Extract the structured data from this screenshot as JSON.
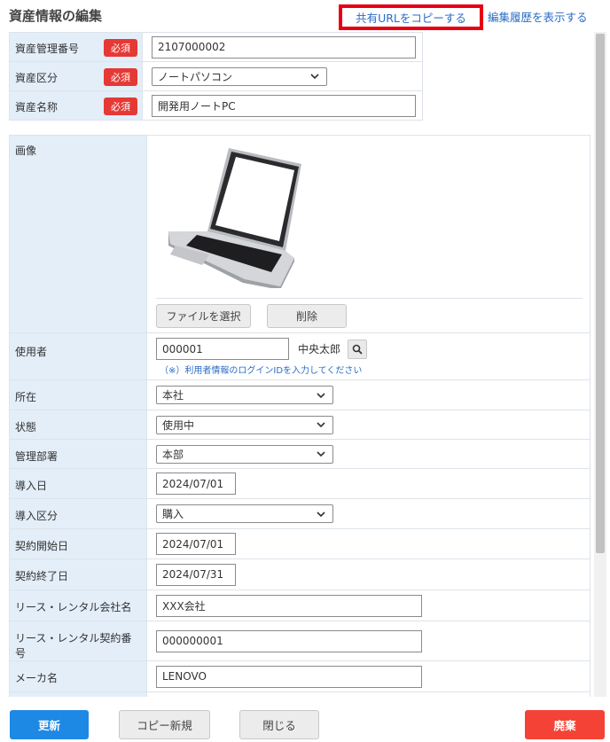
{
  "header": {
    "title": "資産情報の編集",
    "copy_url_link": "共有URLをコピーする",
    "history_link": "編集履歴を表示する"
  },
  "required_badge": "必須",
  "basic": {
    "asset_number": {
      "label": "資産管理番号",
      "value": "2107000002"
    },
    "asset_category": {
      "label": "資産区分",
      "value": "ノートパソコン"
    },
    "asset_name": {
      "label": "資産名称",
      "value": "開発用ノートPC"
    }
  },
  "image": {
    "label": "画像",
    "choose_file_button": "ファイルを選択",
    "delete_button": "削除"
  },
  "user": {
    "label": "使用者",
    "id_value": "000001",
    "name": "中央太郎",
    "hint": "（※）利用者情報のログインIDを入力してください"
  },
  "fields": {
    "location": {
      "label": "所在",
      "value": "本社"
    },
    "status": {
      "label": "状態",
      "value": "使用中"
    },
    "department": {
      "label": "管理部署",
      "value": "本部"
    },
    "introduced_date": {
      "label": "導入日",
      "value": "2024/07/01"
    },
    "introduction_type": {
      "label": "導入区分",
      "value": "購入"
    },
    "contract_start": {
      "label": "契約開始日",
      "value": "2024/07/01"
    },
    "contract_end": {
      "label": "契約終了日",
      "value": "2024/07/31"
    },
    "lease_company": {
      "label": "リース・レンタル会社名",
      "value": "XXX会社"
    },
    "lease_contract_no": {
      "label": "リース・レンタル契約番号",
      "value": "000000001"
    },
    "maker": {
      "label": "メーカ名",
      "value": "LENOVO"
    }
  },
  "footer": {
    "update": "更新",
    "copy_new": "コピー新規",
    "close": "閉じる",
    "discard": "廃棄"
  },
  "colors": {
    "label_bg": "#e3eef9",
    "required": "#e53935",
    "link": "#2a6cc4",
    "highlight_border": "#e60012",
    "primary": "#1e88e5",
    "danger": "#f44336"
  }
}
